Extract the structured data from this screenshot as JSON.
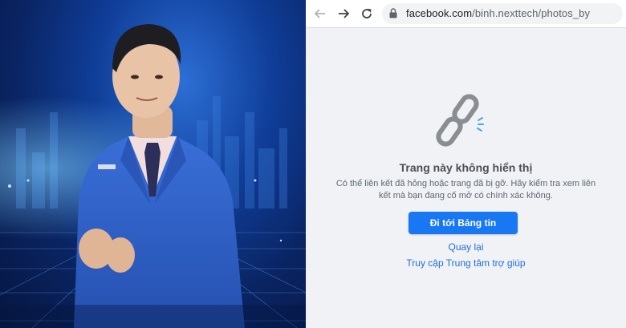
{
  "browser": {
    "url_host": "facebook.com",
    "url_path": "/binh.nexttech/photos_by",
    "icons": [
      "back-arrow-icon",
      "forward-arrow-icon",
      "reload-icon",
      "lock-icon"
    ]
  },
  "error_page": {
    "icon": "broken-link-icon",
    "title": "Trang này không hiển thị",
    "description": "Có thể liên kết đã hỏng hoặc trang đã bị gỡ. Hãy kiểm tra xem liên kết mà bạn đang cố mở có chính xác không.",
    "primary_button": "Đi tới Bảng tin",
    "back_link": "Quay lại",
    "help_link": "Truy cập Trung tâm trợ giúp"
  },
  "colors": {
    "facebook_blue": "#1877f2",
    "link_blue": "#216fdb",
    "page_bg": "#f0f2f5",
    "photo_bg": "#0a2463",
    "suit": "#2f5fc4"
  }
}
